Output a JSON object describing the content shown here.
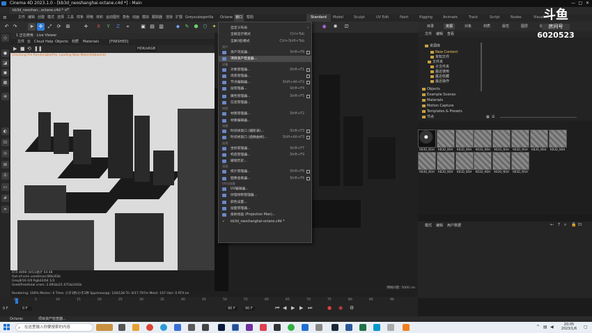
{
  "window": {
    "title": "Cinema 4D 2023.1.0 - [kb3d_neoshanghai-octane.c4d *] - Main"
  },
  "tabs": [
    {
      "label": "kb3d_neoshan...octane.c4d *"
    }
  ],
  "menubar": {
    "items": [
      "文件",
      "编辑",
      "创建",
      "模式",
      "选择",
      "工具",
      "样条",
      "网格",
      "体积",
      "运动图形",
      "角色",
      "动画",
      "模拟",
      "跟踪器",
      "渲染",
      "扩展",
      "Greyscalegorilla",
      "Octane",
      "窗口",
      "帮助"
    ],
    "active": "窗口",
    "layouts": [
      "Standard",
      "Model",
      "Sculpt",
      "UV Edit",
      "Paint",
      "Rigging",
      "Animate",
      "Track",
      "Script",
      "Nodes",
      "Visualize"
    ]
  },
  "viewport1": {
    "header": "1 正在使用 · Live Viewer",
    "menu": [
      "文件",
      "云",
      "Cloud",
      "Help",
      "Objects",
      "材质",
      "Materials",
      "[FINISHED]"
    ],
    "toolbar_value": "HDR/sRGB",
    "overlay_text": "Checking Pro Renderable/Pro. Loading New Mater/kitbash3d",
    "status_lines": [
      "RTX 4090 (0/1)/总计 54 48",
      "Out-of-core used/max:0Kb/4Gb",
      "Grey8/16 0/0 Rgb32/64 1/3",
      "Used/free/total vram: 2.69Gb/21.07Gb/24Gb"
    ],
    "render_info": "Rendering: 100% Ms/sec: 0 Time: 小于1秒/小于1秒 Spp/maxspp: 128/128 Tri: 0/17.797m Mesh: 107 Hair: 0 RTX:on"
  },
  "viewport2": {
    "label": "网格间距: 5000 cm"
  },
  "window_menu": {
    "items": [
      {
        "label": "自定义布局",
        "section": "",
        "shortcut": "",
        "has_submenu": true
      },
      {
        "label": "全屏显示模式",
        "section": "",
        "shortcut": "Ctrl+Tab"
      },
      {
        "label": "全屏(组)模式",
        "section": "",
        "shortcut": "Ctrl+Shift+Tab"
      },
      {
        "label": "资产浏览器...",
        "section": "资产",
        "shortcut": "Shift+F8",
        "ext": true
      },
      {
        "label": "项目资产检查器...",
        "section": "",
        "shortcut": "",
        "highlight": true
      },
      {
        "label": "对象管理器...",
        "section": "对象",
        "shortcut": "Shift+F1",
        "ext": true
      },
      {
        "label": "场景管理器...",
        "section": "",
        "shortcut": "",
        "ext": true
      },
      {
        "label": "节点编辑器...",
        "section": "",
        "shortcut": "Shift+Alt+F2",
        "ext": true
      },
      {
        "label": "层管理器...",
        "section": "",
        "shortcut": "Shift+F4"
      },
      {
        "label": "属性管理器...",
        "section": "",
        "shortcut": "Shift+F5",
        "ext": true
      },
      {
        "label": "信息管理器...",
        "section": "",
        "shortcut": ""
      },
      {
        "label": "材质管理器...",
        "section": "材质",
        "shortcut": "Shift+F2"
      },
      {
        "label": "材质编辑器...",
        "section": "",
        "shortcut": ""
      },
      {
        "label": "时间线窗口 (摄影表)...",
        "section": "动画",
        "shortcut": "Shift+F3",
        "ext": true
      },
      {
        "label": "时间线窗口 (函数曲线)...",
        "section": "",
        "shortcut": "Shift+Alt+F3",
        "ext": true
      },
      {
        "label": "坐标管理器...",
        "section": "选项",
        "shortcut": "Shift+F7"
      },
      {
        "label": "构造管理器...",
        "section": "",
        "shortcut": "Shift+F9"
      },
      {
        "label": "撤销历史...",
        "section": "",
        "shortcut": ""
      },
      {
        "label": "统计管理器...",
        "section": "渲染",
        "shortcut": "Shift+F6",
        "ext": true
      },
      {
        "label": "图像查看器...",
        "section": "",
        "shortcut": "Shift+F6",
        "ext": true
      },
      {
        "label": "UV编辑器...",
        "section": "UV与纹理",
        "shortcut": ""
      },
      {
        "label": "纹理绘制管理器...",
        "section": "",
        "shortcut": ""
      },
      {
        "label": "颜色设置...",
        "section": "",
        "shortcut": ""
      },
      {
        "label": "层面管理器...",
        "section": "",
        "shortcut": ""
      },
      {
        "label": "投射绘画 (Projection Man)...",
        "section": "",
        "shortcut": ""
      },
      {
        "label": "kb3d_neoshanghai-octane.c4d *",
        "section": "",
        "shortcut": "",
        "checked": true
      }
    ]
  },
  "right_panel": {
    "tabs": [
      "目录",
      "资源",
      "对象",
      "材质",
      "属性",
      "图层",
      "结构",
      "约束"
    ],
    "active_tab": "资源",
    "menu": [
      "文件",
      "编辑",
      "查看"
    ],
    "tree": [
      "资源库",
      "New Content",
      "未知文件",
      "文件夹",
      "子文件夹",
      "最近使用",
      "最近收藏",
      "最近操作",
      "Objects",
      "Example Scenes",
      "Materials",
      "Motion Capture",
      "Templates & Presets",
      "节点"
    ],
    "thumb_label": "KB3D_NSH",
    "attr_menu": [
      "模式",
      "编辑",
      "用户数据"
    ]
  },
  "timeline": {
    "ticks": [
      "0",
      "5",
      "10",
      "15",
      "20",
      "25",
      "30",
      "35",
      "40",
      "45",
      "50",
      "55",
      "60",
      "65",
      "70",
      "75",
      "80",
      "85",
      "90"
    ],
    "start": "0 F",
    "end": "90 F",
    "end2": "90 F",
    "current": "0 F"
  },
  "statusbar": {
    "app": "Octane:",
    "message": "项目资产检查器..."
  },
  "taskbar": {
    "search_placeholder": "在这里输入你要搜索的内容",
    "clock_time": "20:05",
    "clock_date": "2023/1/6"
  },
  "watermark": {
    "brand": "斗鱼",
    "sub": "房间号",
    "room": "6020523"
  },
  "colors": {
    "accent": "#2f7bd6",
    "menu_highlight": "#4a4a4a",
    "folder": "#c8a040"
  }
}
